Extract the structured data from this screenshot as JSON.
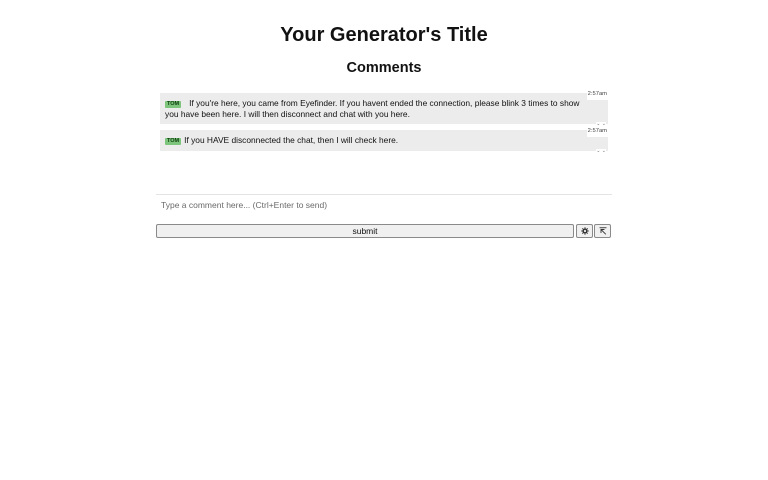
{
  "page": {
    "title": "Your Generator's Title",
    "comments_heading": "Comments"
  },
  "comments": [
    {
      "badge": "TOM",
      "time": "2:57am",
      "text": "If you're here, you came from Eyefinder. If you havent ended the connection, please blink 3 times to show you have been here. I will then disconnect and chat with you here."
    },
    {
      "badge": "TOM",
      "time": "2:57am",
      "text": "If you HAVE disconnected the chat, then I will check here."
    }
  ],
  "composer": {
    "placeholder": "Type a comment here... (Ctrl+Enter to send)",
    "value": "",
    "submit_label": "submit",
    "settings_icon": "gear-icon",
    "popout_icon": "expand-arrow-icon"
  },
  "colors": {
    "badge_bg": "#7dc47d",
    "comment_bg": "#ececec"
  }
}
